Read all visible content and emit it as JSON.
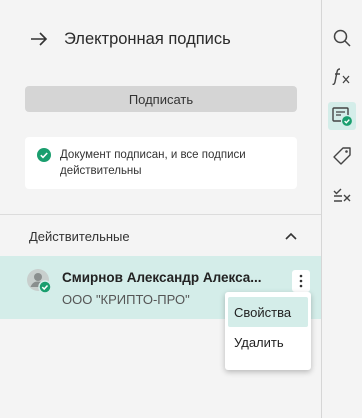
{
  "panel": {
    "title": "Электронная подпись",
    "sign_button": "Подписать",
    "status_text": "Документ подписан, и все подписи действительны"
  },
  "section": {
    "title": "Действительные"
  },
  "signer": {
    "name": "Смирнов Александр Алекса...",
    "organization": "ООО \"КРИПТО-ПРО\""
  },
  "context_menu": {
    "items": [
      "Свойства",
      "Удалить"
    ]
  },
  "rail": {
    "icons": [
      "search-icon",
      "formula-icon",
      "signature-icon",
      "tag-icon",
      "checklist-icon"
    ]
  },
  "colors": {
    "accent": "#1a9e6e",
    "selection": "#d4ede9"
  }
}
